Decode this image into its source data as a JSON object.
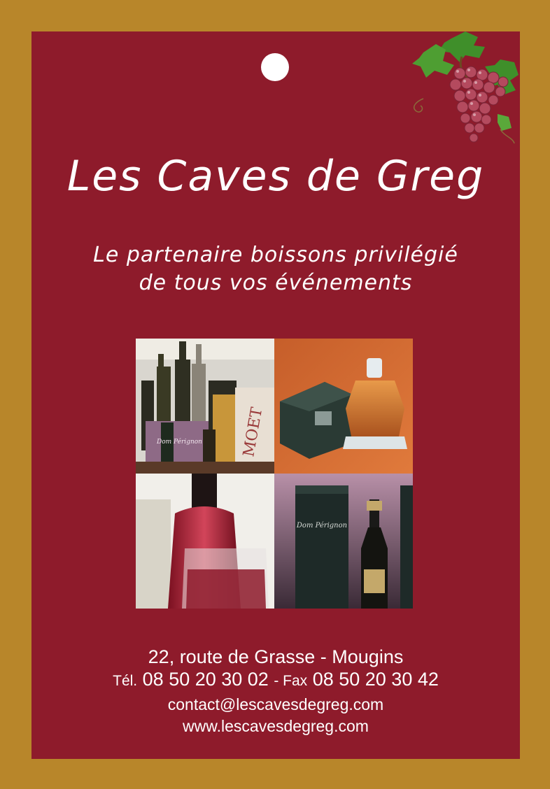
{
  "card": {
    "title": "Les Caves de Greg",
    "tagline_line1": "Le partenaire boissons privilégié",
    "tagline_line2": "de tous vos événements",
    "address": "22, route de Grasse  - Mougins",
    "phone_label": "Tél.",
    "phone": "08 50 20 30 02",
    "fax_label": "- Fax",
    "fax": "08 50 20 30 42",
    "email": "contact@lescavesdegreg.com",
    "website": "www.lescavesdegreg.com"
  },
  "collage": {
    "bottle_label": "Dom Pérignon",
    "box_label": "MOET"
  },
  "colors": {
    "border": "#b8862a",
    "card": "#8e1b2b",
    "text": "#ffffff"
  },
  "icons": [
    "hang-hole",
    "grape-cluster-icon"
  ]
}
